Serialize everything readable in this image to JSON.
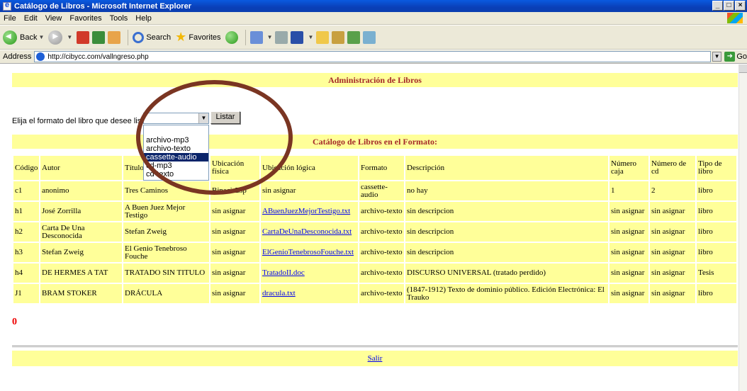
{
  "window": {
    "title": "Catálogo de Libros - Microsoft Internet Explorer",
    "btn_min": "_",
    "btn_max": "□",
    "btn_close": "×"
  },
  "menu": [
    "File",
    "Edit",
    "View",
    "Favorites",
    "Tools",
    "Help"
  ],
  "toolbar": {
    "back": "Back",
    "search": "Search",
    "favorites": "Favorites"
  },
  "address": {
    "label": "Address",
    "url": "http://cibycc.com/vallngreso.php",
    "go": "Go"
  },
  "page": {
    "admin_title": "Administración de Libros",
    "prompt": "Elija el formato del libro que desee listar",
    "select_value": "",
    "button": "Listar",
    "dropdown_options": [
      "",
      "archivo-mp3",
      "archivo-texto",
      "cassette-audio",
      "cd-mp3",
      "cd-texto"
    ],
    "dropdown_selected": "cassette-audio",
    "catalog_title": "Catálogo de Libros en el Formato:",
    "columns": [
      "Código",
      "Autor",
      "Título",
      "Ubicación física",
      "Ubicación lógica",
      "Formato",
      "Descripción",
      "Número caja",
      "Número de cd",
      "Tipo de libro"
    ],
    "rows": [
      {
        "codigo": "c1",
        "autor": "anonimo",
        "titulo": "Tres Caminos",
        "fisica": "Binaci-Esp",
        "logica": "sin asignar",
        "logica_link": false,
        "formato": "cassette-audio",
        "descripcion": "no hay",
        "caja": "1",
        "cd": "2",
        "tipo": "libro"
      },
      {
        "codigo": "h1",
        "autor": "José Zorrilla",
        "titulo": "A Buen Juez Mejor Testigo",
        "fisica": "sin asignar",
        "logica": "ABuenJuezMejorTestigo.txt",
        "logica_link": true,
        "formato": "archivo-texto",
        "descripcion": "sin descripcion",
        "caja": "sin asignar",
        "cd": "sin asignar",
        "tipo": "libro"
      },
      {
        "codigo": "h2",
        "autor": "Carta De Una Desconocida",
        "titulo": "Stefan Zweig",
        "fisica": "sin asignar",
        "logica": "CartaDeUnaDesconocida.txt",
        "logica_link": true,
        "formato": "archivo-texto",
        "descripcion": "sin descripcion",
        "caja": "sin asignar",
        "cd": "sin asignar",
        "tipo": "libro"
      },
      {
        "codigo": "h3",
        "autor": "Stefan Zweig",
        "titulo": "El Genio Tenebroso Fouche",
        "fisica": "sin asignar",
        "logica": "ElGenioTenebrosoFouche.txt",
        "logica_link": true,
        "formato": "archivo-texto",
        "descripcion": "sin descripcion",
        "caja": "sin asignar",
        "cd": "sin asignar",
        "tipo": "libro"
      },
      {
        "codigo": "h4",
        "autor": "DE HERMES A TAT",
        "titulo": "TRATADO SIN TITULO",
        "fisica": "sin asignar",
        "logica": "TratadoII.doc",
        "logica_link": true,
        "formato": "archivo-texto",
        "descripcion": "DISCURSO UNIVERSAL (tratado perdido)",
        "caja": "sin asignar",
        "cd": "sin asignar",
        "tipo": "Tesis"
      },
      {
        "codigo": "J1",
        "autor": "BRAM STOKER",
        "titulo": "DRÁCULA",
        "fisica": "sin asignar",
        "logica": "dracula.txt",
        "logica_link": true,
        "formato": "archivo-texto",
        "descripcion": "(1847-1912) Texto de dominio público. Edición Electrónica: El Trauko",
        "caja": "sin asignar",
        "cd": "sin asignar",
        "tipo": "libro"
      }
    ],
    "count": "0",
    "salir": "Salir"
  }
}
